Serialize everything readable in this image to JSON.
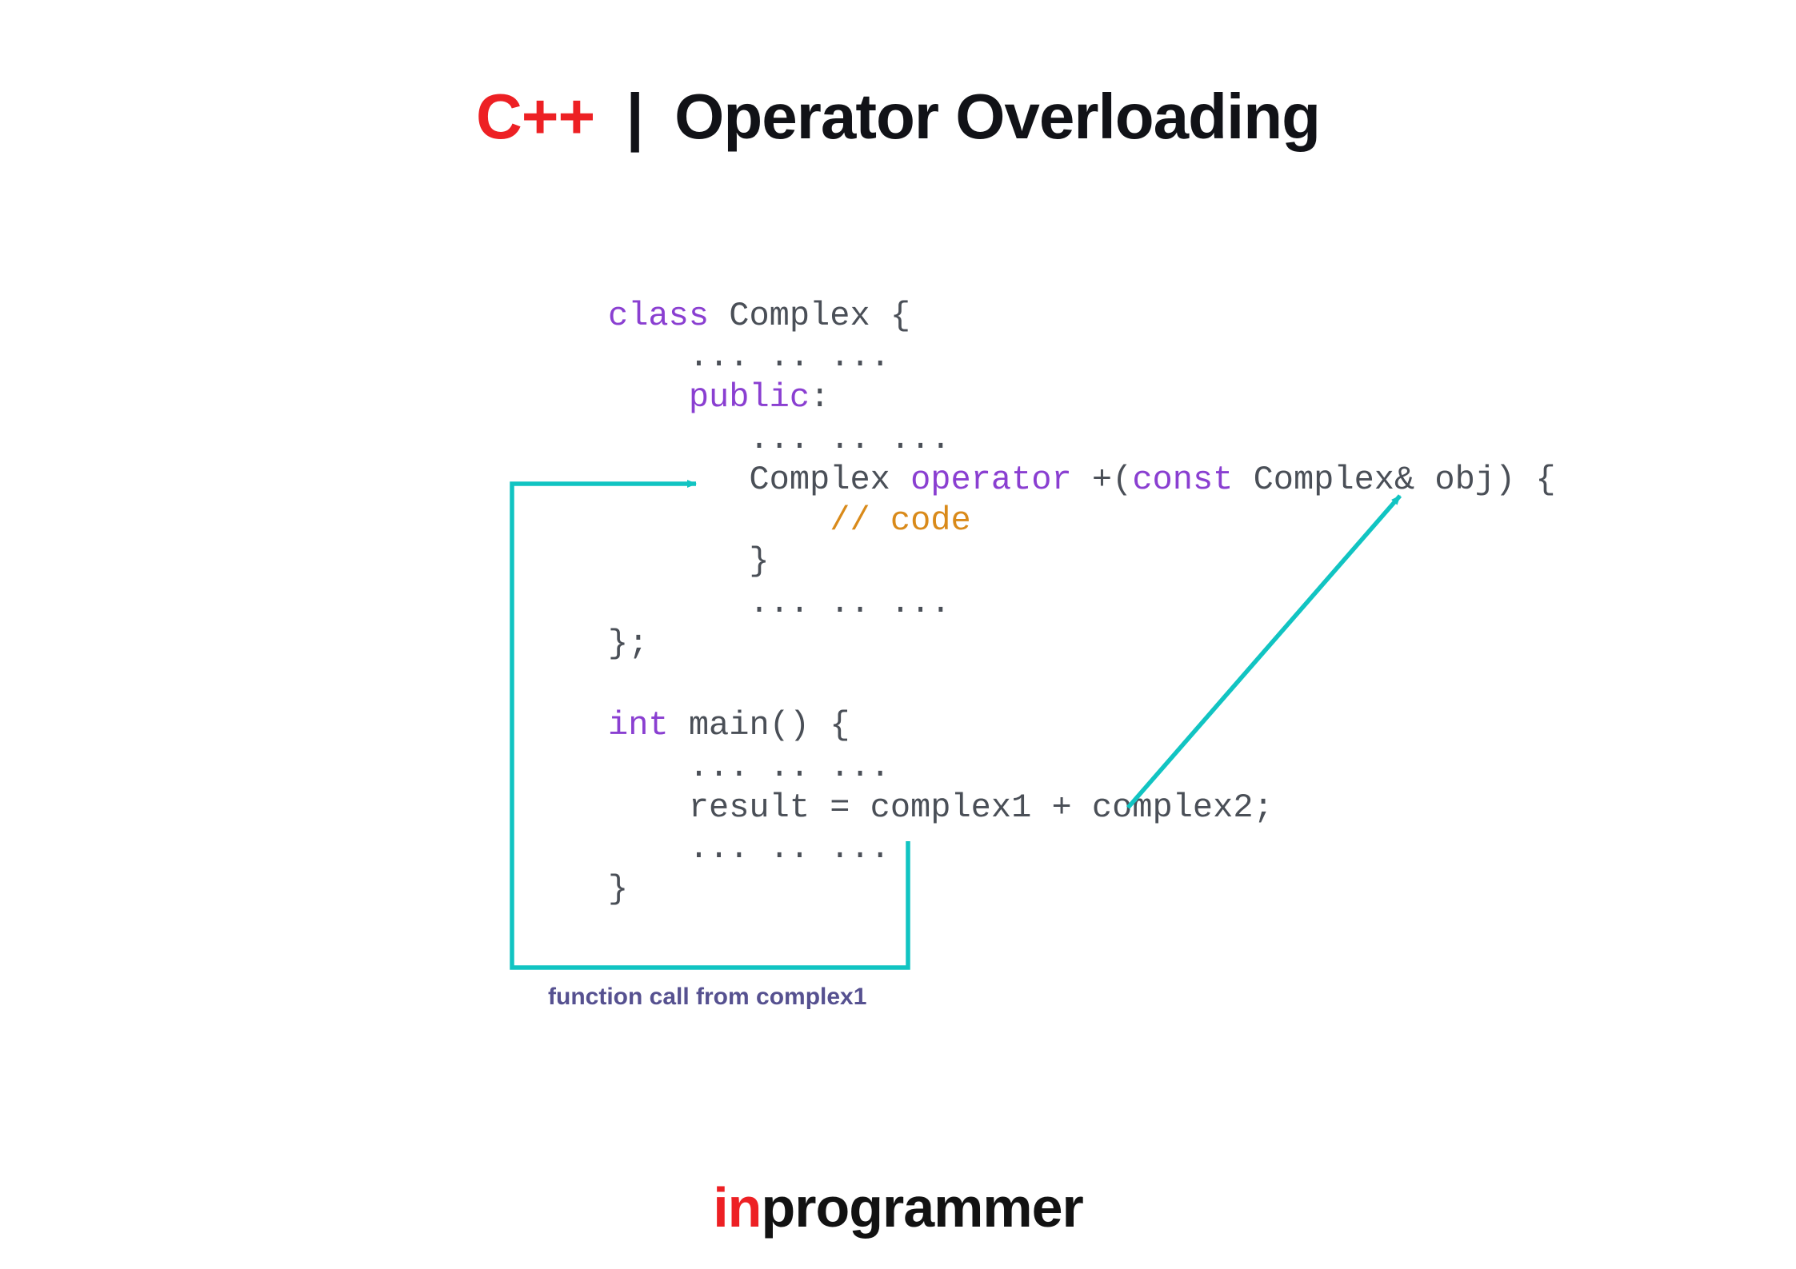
{
  "title": {
    "prefix": "C++",
    "separator": "|",
    "rest": "Operator Overloading"
  },
  "code": {
    "tokens": [
      [
        {
          "t": "class",
          "c": "keyword"
        },
        {
          "t": " Complex {",
          "c": "default"
        }
      ],
      [
        {
          "t": "    ... .. ...",
          "c": "default"
        }
      ],
      [
        {
          "t": "    ",
          "c": "default"
        },
        {
          "t": "public",
          "c": "keyword"
        },
        {
          "t": ":",
          "c": "default"
        }
      ],
      [
        {
          "t": "       ... .. ...",
          "c": "default"
        }
      ],
      [
        {
          "t": "       Complex ",
          "c": "default"
        },
        {
          "t": "operator",
          "c": "keyword"
        },
        {
          "t": " +(",
          "c": "default"
        },
        {
          "t": "const",
          "c": "keyword"
        },
        {
          "t": " Complex& obj) {",
          "c": "default"
        }
      ],
      [
        {
          "t": "           ",
          "c": "default"
        },
        {
          "t": "// code",
          "c": "comment"
        }
      ],
      [
        {
          "t": "       }",
          "c": "default"
        }
      ],
      [
        {
          "t": "       ... .. ...",
          "c": "default"
        }
      ],
      [
        {
          "t": "};",
          "c": "default"
        }
      ],
      [
        {
          "t": " ",
          "c": "default"
        }
      ],
      [
        {
          "t": "int",
          "c": "keyword"
        },
        {
          "t": " main() {",
          "c": "default"
        }
      ],
      [
        {
          "t": "    ... .. ...",
          "c": "default"
        }
      ],
      [
        {
          "t": "    result = complex1 + complex2;",
          "c": "default"
        }
      ],
      [
        {
          "t": "    ... .. ...",
          "c": "default"
        }
      ],
      [
        {
          "t": "}",
          "c": "default"
        }
      ]
    ]
  },
  "caption": "function call from complex1",
  "footer": {
    "prefix": "in",
    "rest": "programmer"
  },
  "colors": {
    "accent": "#ed2024",
    "arrow": "#11c4c2",
    "keyword": "#8a3fd1",
    "comment": "#d98a1a",
    "caption": "#565190"
  }
}
